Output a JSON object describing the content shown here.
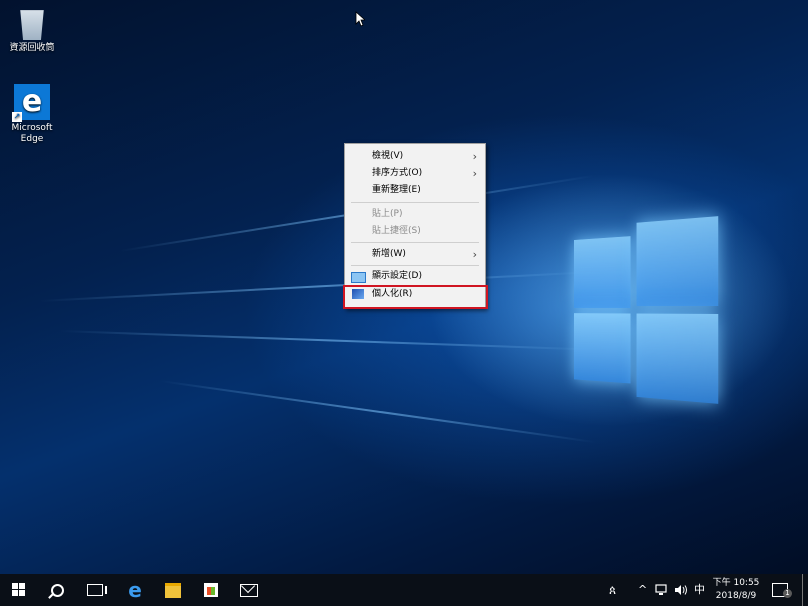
{
  "desktop": {
    "icons": [
      {
        "label": "資源回收筒"
      },
      {
        "label": "Microsoft Edge"
      }
    ]
  },
  "context_menu": {
    "items": [
      {
        "label": "檢視(V)",
        "submenu": true,
        "enabled": true
      },
      {
        "label": "排序方式(O)",
        "submenu": true,
        "enabled": true
      },
      {
        "label": "重新整理(E)",
        "submenu": false,
        "enabled": true
      },
      {
        "label": "貼上(P)",
        "submenu": false,
        "enabled": false
      },
      {
        "label": "貼上捷徑(S)",
        "submenu": false,
        "enabled": false
      },
      {
        "label": "新增(W)",
        "submenu": true,
        "enabled": true
      },
      {
        "label": "顯示設定(D)",
        "submenu": false,
        "enabled": true
      },
      {
        "label": "個人化(R)",
        "submenu": false,
        "enabled": true
      }
    ],
    "highlighted_item": "個人化(R)",
    "highlight_color": "#d01522"
  },
  "taskbar": {
    "pinned": [
      "windows-start-icon",
      "search-icon",
      "task-view-icon",
      "edge-icon",
      "file-explorer-icon",
      "store-icon",
      "mail-icon"
    ],
    "tray": {
      "people_glyph": "ጰ",
      "chevron": "^",
      "ime": "中",
      "time_prefix": "下午",
      "time": "10:55",
      "date": "2018/8/9",
      "notification_count": "1"
    }
  }
}
